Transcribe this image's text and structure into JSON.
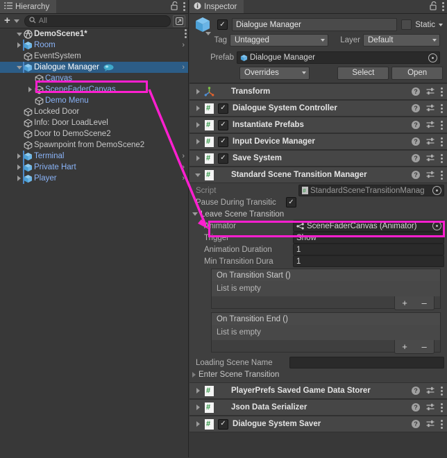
{
  "hierarchy": {
    "tab_label": "Hierarchy",
    "tab_icon": "hierarchy-icon",
    "lock_icon": "lock-open-icon",
    "menu_icon": "kebab-menu-icon",
    "toolbar": {
      "add_label": "+",
      "add_caret_icon": "chevron-down-icon",
      "search_icon": "search-icon",
      "search_placeholder": "All",
      "search_value": "",
      "panel_icon": "open-in-new-icon"
    },
    "scene": {
      "name": "DemoScene1*",
      "icon": "unity-scene-icon",
      "expanded": true,
      "menu_icon": "kebab-menu-icon"
    },
    "items": [
      {
        "label": "Room",
        "indent": 1,
        "icon": "prefab-cube-icon",
        "blue": true,
        "arrow": "right",
        "prefab_bar": true,
        "chevron": true
      },
      {
        "label": "EventSystem",
        "indent": 1,
        "icon": "gameobject-cube-icon",
        "blue": false,
        "arrow": "none",
        "prefab_bar": false,
        "chevron": false
      },
      {
        "label": "Dialogue Manager",
        "indent": 1,
        "icon": "prefab-cube-icon",
        "blue": false,
        "arrow": "down",
        "prefab_bar": true,
        "chevron": true,
        "selected": true,
        "badge": "dialogue-bubble-icon"
      },
      {
        "label": "Canvas",
        "indent": 2,
        "icon": "gameobject-cube-icon",
        "blue": true,
        "arrow": "none",
        "prefab_bar": false,
        "chevron": false
      },
      {
        "label": "SceneFaderCanvas",
        "indent": 2,
        "icon": "gameobject-cube-icon",
        "blue": true,
        "arrow": "right",
        "prefab_bar": false,
        "chevron": false,
        "highlighted": true
      },
      {
        "label": "Demo Menu",
        "indent": 2,
        "icon": "gameobject-cube-icon",
        "blue": true,
        "arrow": "none",
        "prefab_bar": false,
        "chevron": false
      },
      {
        "label": "Locked Door",
        "indent": 1,
        "icon": "gameobject-cube-icon",
        "blue": false,
        "arrow": "none",
        "prefab_bar": false,
        "chevron": false
      },
      {
        "label": "Info: Door LoadLevel",
        "indent": 1,
        "icon": "gameobject-cube-icon",
        "blue": false,
        "arrow": "none",
        "prefab_bar": false,
        "chevron": false
      },
      {
        "label": "Door to DemoScene2",
        "indent": 1,
        "icon": "gameobject-cube-icon",
        "blue": false,
        "arrow": "none",
        "prefab_bar": false,
        "chevron": false
      },
      {
        "label": "Spawnpoint from DemoScene2",
        "indent": 1,
        "icon": "gameobject-cube-icon",
        "blue": false,
        "arrow": "none",
        "prefab_bar": false,
        "chevron": false
      },
      {
        "label": "Terminal",
        "indent": 1,
        "icon": "prefab-cube-icon",
        "blue": true,
        "arrow": "right",
        "prefab_bar": true,
        "chevron": true
      },
      {
        "label": "Private Hart",
        "indent": 1,
        "icon": "prefab-cube-icon",
        "blue": true,
        "arrow": "right",
        "prefab_bar": true,
        "chevron": true
      },
      {
        "label": "Player",
        "indent": 1,
        "icon": "prefab-cube-icon",
        "blue": true,
        "arrow": "right",
        "prefab_bar": true,
        "chevron": true
      }
    ]
  },
  "inspector": {
    "tab_label": "Inspector",
    "tab_icon": "info-icon",
    "lock_icon": "lock-open-icon",
    "menu_icon": "kebab-menu-icon",
    "gameobject": {
      "icon": "prefab-cube-icon",
      "active_checked": true,
      "name": "Dialogue Manager",
      "static_label": "Static",
      "static_checked": false,
      "static_caret_icon": "chevron-down-icon",
      "tag_label": "Tag",
      "tag_value": "Untagged",
      "layer_label": "Layer",
      "layer_value": "Default"
    },
    "prefab": {
      "label": "Prefab",
      "value": "Dialogue Manager",
      "value_icon": "prefab-blue-cube-icon",
      "picker_icon": "object-picker-icon",
      "overrides_label": "Overrides",
      "overrides_caret_icon": "chevron-down-icon",
      "select_label": "Select",
      "open_label": "Open"
    },
    "components": [
      {
        "name": "Transform",
        "icon": "transform-axis-icon",
        "has_checkbox": false,
        "expanded": false
      },
      {
        "name": "Dialogue System Controller",
        "icon": "cs-script-icon",
        "has_checkbox": true,
        "checked": true,
        "expanded": false
      },
      {
        "name": "Instantiate Prefabs",
        "icon": "cs-script-icon",
        "has_checkbox": true,
        "checked": true,
        "expanded": false
      },
      {
        "name": "Input Device Manager",
        "icon": "cs-script-icon",
        "has_checkbox": true,
        "checked": true,
        "expanded": false
      },
      {
        "name": "Save System",
        "icon": "cs-script-icon",
        "has_checkbox": true,
        "checked": true,
        "expanded": false
      },
      {
        "name": "Standard Scene Transition Manager",
        "icon": "cs-script-icon",
        "has_checkbox": false,
        "expanded": true
      }
    ],
    "transition_manager": {
      "script_label": "Script",
      "script_value": "StandardSceneTransitionManag",
      "script_icon": "cs-script-icon-small",
      "script_picker_icon": "object-picker-icon",
      "pause_label": "Pause During Transitic",
      "pause_checked": true,
      "leave_label": "Leave Scene Transition",
      "leave_expanded": true,
      "animator_label": "Animator",
      "animator_value": "SceneFaderCanvas (Animator)",
      "animator_icon": "animator-icon",
      "animator_picker_icon": "object-picker-icon",
      "trigger_label": "Trigger",
      "trigger_value": "Show",
      "anim_duration_label": "Animation Duration",
      "anim_duration_value": "1",
      "min_transition_label": "Min Transition Dura",
      "min_transition_value": "1",
      "on_start_label": "On Transition Start ()",
      "on_start_empty": "List is empty",
      "on_end_label": "On Transition End ()",
      "on_end_empty": "List is empty",
      "add_label": "+",
      "remove_label": "–",
      "loading_scene_label": "Loading Scene Name",
      "loading_scene_value": "",
      "enter_label": "Enter Scene Transition",
      "enter_expanded": false
    },
    "components_bottom": [
      {
        "name": "PlayerPrefs Saved Game Data Storer",
        "icon": "cs-script-icon",
        "has_checkbox": false,
        "expanded": false
      },
      {
        "name": "Json Data Serializer",
        "icon": "cs-script-icon",
        "has_checkbox": false,
        "expanded": false
      },
      {
        "name": "Dialogue System Saver",
        "icon": "cs-script-icon",
        "has_checkbox": true,
        "checked": true,
        "expanded": false
      }
    ],
    "row_icons": {
      "help": "help-icon",
      "preset": "preset-icon",
      "menu": "kebab-menu-icon"
    }
  },
  "annotations": {
    "color": "#ff1fd0",
    "box_hierarchy_name": "SceneFaderCanvas",
    "box_inspector_name": "Animator",
    "arrow": "callout-arrow"
  }
}
